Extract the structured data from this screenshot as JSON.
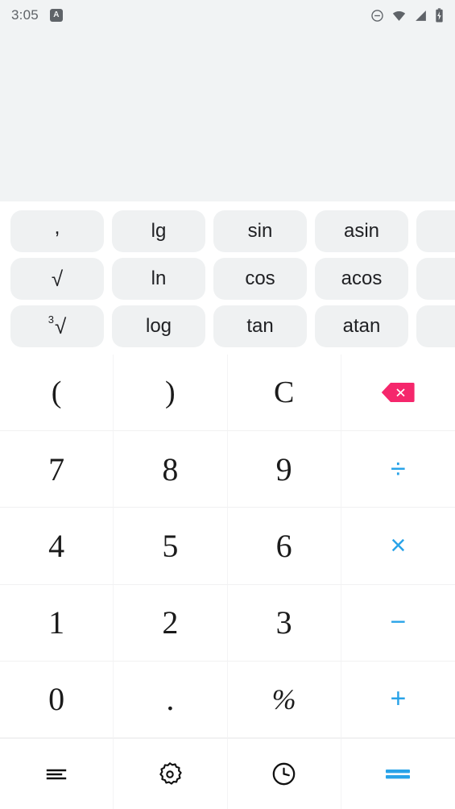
{
  "status_bar": {
    "time": "3:05",
    "app_badge_letter": "A",
    "icons": [
      {
        "name": "do-not-disturb-icon",
        "label": "Do Not Disturb"
      },
      {
        "name": "wifi-icon",
        "label": "Wi-Fi"
      },
      {
        "name": "cellular-signal-icon",
        "label": "Signal"
      },
      {
        "name": "battery-charging-icon",
        "label": "Battery charging"
      }
    ],
    "icon_color": "#5f6368",
    "background": "#f1f3f4"
  },
  "display": {
    "expression": "",
    "result": "",
    "background": "#f1f3f4"
  },
  "scientific_panel": {
    "background": "#ffffff",
    "button_background": "#eff1f2",
    "rows": [
      [
        {
          "label": ",",
          "name": "sci-comma"
        },
        {
          "label": "lg",
          "name": "sci-lg"
        },
        {
          "label": "sin",
          "name": "sci-sin"
        },
        {
          "label": "asin",
          "name": "sci-asin"
        },
        {
          "label": "",
          "name": "sci-hidden-1"
        }
      ],
      [
        {
          "label": "√",
          "name": "sci-sqrt"
        },
        {
          "label": "ln",
          "name": "sci-ln"
        },
        {
          "label": "cos",
          "name": "sci-cos"
        },
        {
          "label": "acos",
          "name": "sci-acos"
        },
        {
          "label": "",
          "name": "sci-hidden-2"
        }
      ],
      [
        {
          "label": "3√",
          "name": "sci-cbrt"
        },
        {
          "label": "log",
          "name": "sci-log"
        },
        {
          "label": "tan",
          "name": "sci-tan"
        },
        {
          "label": "atan",
          "name": "sci-atan"
        },
        {
          "label": "",
          "name": "sci-hidden-3"
        }
      ]
    ],
    "cube_root_index": "3",
    "radical_glyph": "√"
  },
  "keypad": {
    "number_color": "#1b1b1b",
    "operator_color": "#29a3e8",
    "backspace_color": "#f5276c",
    "keys": [
      {
        "label": "(",
        "name": "key-open-paren",
        "type": "paren"
      },
      {
        "label": ")",
        "name": "key-close-paren",
        "type": "paren"
      },
      {
        "label": "C",
        "name": "key-clear",
        "type": "clear"
      },
      {
        "label": "⌫",
        "name": "key-backspace",
        "type": "backspace"
      },
      {
        "label": "7",
        "name": "key-7",
        "type": "num"
      },
      {
        "label": "8",
        "name": "key-8",
        "type": "num"
      },
      {
        "label": "9",
        "name": "key-9",
        "type": "num"
      },
      {
        "label": "÷",
        "name": "key-divide",
        "type": "op"
      },
      {
        "label": "4",
        "name": "key-4",
        "type": "num"
      },
      {
        "label": "5",
        "name": "key-5",
        "type": "num"
      },
      {
        "label": "6",
        "name": "key-6",
        "type": "num"
      },
      {
        "label": "×",
        "name": "key-multiply",
        "type": "op"
      },
      {
        "label": "1",
        "name": "key-1",
        "type": "num"
      },
      {
        "label": "2",
        "name": "key-2",
        "type": "num"
      },
      {
        "label": "3",
        "name": "key-3",
        "type": "num"
      },
      {
        "label": "−",
        "name": "key-subtract",
        "type": "op"
      },
      {
        "label": "0",
        "name": "key-0",
        "type": "num"
      },
      {
        "label": ".",
        "name": "key-decimal",
        "type": "dot"
      },
      {
        "label": "%",
        "name": "key-percent",
        "type": "percent"
      },
      {
        "label": "+",
        "name": "key-add",
        "type": "op"
      }
    ]
  },
  "bottom_bar": {
    "items": [
      {
        "name": "menu-icon",
        "label": "Menu"
      },
      {
        "name": "gear-icon",
        "label": "Settings"
      },
      {
        "name": "history-clock-icon",
        "label": "History"
      },
      {
        "name": "equals-icon",
        "label": "Equals"
      }
    ],
    "equals_color": "#29a3e8",
    "icon_color": "#111111"
  }
}
